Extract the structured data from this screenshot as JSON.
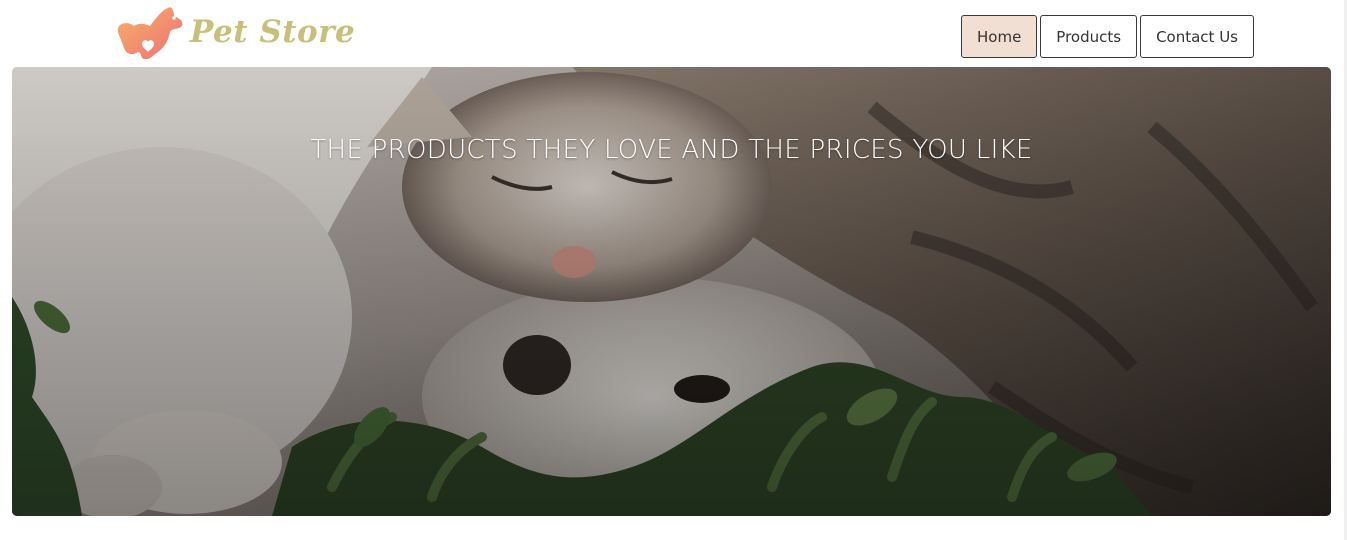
{
  "brand": {
    "name": "Pet Store",
    "logo_icon": "dog-heart-logo-icon",
    "colors": {
      "logo_text": "#c8c07a",
      "logo_mark_start": "#f07a6a",
      "logo_mark_end": "#f6b26b"
    }
  },
  "nav": {
    "items": [
      {
        "label": "Home",
        "active": true
      },
      {
        "label": "Products",
        "active": false
      },
      {
        "label": "Contact Us",
        "active": false
      }
    ],
    "colors": {
      "active_bg": "#f2dfd3",
      "border": "#3a3a3a"
    }
  },
  "hero": {
    "tagline": "THE PRODUCTS THEY LOVE AND THE PRICES YOU LIKE",
    "image": "cat-and-dog-lying-on-grass-photo"
  }
}
